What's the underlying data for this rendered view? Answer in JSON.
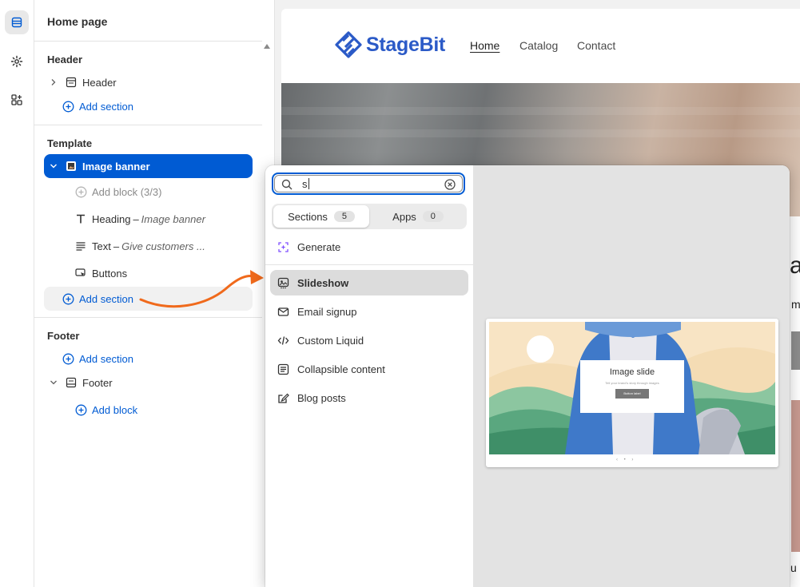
{
  "rail": {
    "icons": [
      "sections-icon",
      "gear-icon",
      "apps-icon"
    ]
  },
  "sidebar": {
    "title": "Home page",
    "header_group": {
      "heading": "Header",
      "item_label": "Header",
      "add_section": "Add section"
    },
    "template_group": {
      "heading": "Template",
      "selected_item": "Image banner",
      "add_block": "Add block (3/3)",
      "blocks": [
        {
          "label": "Heading",
          "detail": "Image banner"
        },
        {
          "label": "Text",
          "detail": "Give customers ..."
        },
        {
          "label": "Buttons",
          "detail": ""
        }
      ],
      "add_section": "Add section"
    },
    "footer_group": {
      "heading": "Footer",
      "add_section": "Add section",
      "item_label": "Footer",
      "add_block": "Add block"
    }
  },
  "preview": {
    "logo_text": "StageBit",
    "nav": [
      "Home",
      "Catalog",
      "Contact"
    ],
    "active_nav": "Home",
    "fragments": [
      "a",
      "m",
      "u"
    ]
  },
  "picker": {
    "search_value": "s",
    "tabs": [
      {
        "label": "Sections",
        "count": "5",
        "active": true
      },
      {
        "label": "Apps",
        "count": "0",
        "active": false
      }
    ],
    "generate_label": "Generate",
    "items": [
      {
        "label": "Slideshow",
        "icon": "slideshow-icon",
        "selected": true
      },
      {
        "label": "Email signup",
        "icon": "mail-icon",
        "selected": false
      },
      {
        "label": "Custom Liquid",
        "icon": "code-icon",
        "selected": false
      },
      {
        "label": "Collapsible content",
        "icon": "collapsible-icon",
        "selected": false
      },
      {
        "label": "Blog posts",
        "icon": "blog-icon",
        "selected": false
      }
    ],
    "preview": {
      "slide_title": "Image slide",
      "slide_subtitle": "Tell your brand's story through images",
      "slide_button": "Button label"
    }
  },
  "colors": {
    "accent": "#005bd3",
    "logo": "#2b5ac7",
    "arrow": "#f06a1c",
    "generate_icon": "#8051ff"
  }
}
